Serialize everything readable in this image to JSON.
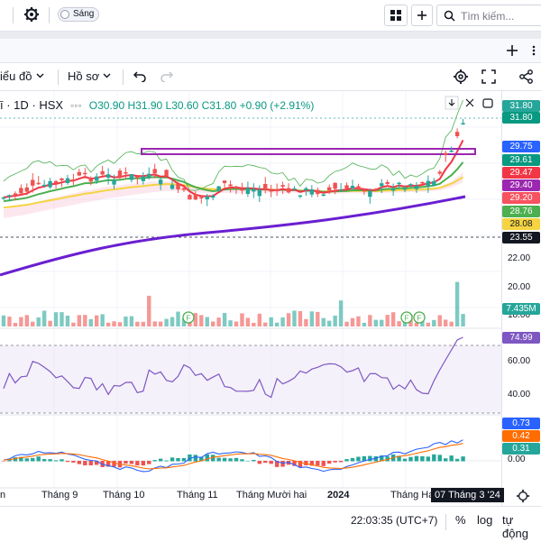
{
  "topbar": {
    "theme_toggle_label": "Sáng",
    "search_placeholder": "Tìm kiếm..."
  },
  "toolbar": {
    "indicators_label": "iểu đồ",
    "templates_label": "Hồ sơ"
  },
  "legend": {
    "symbol": "ī · 1D · HSX",
    "open": "O30.90",
    "high": "H31.90",
    "low": "L30.60",
    "close": "C31.80",
    "change": "+0.90 (+2.91%)"
  },
  "price_axis": {
    "tags": [
      {
        "text": "31.80",
        "color": "#26a69a"
      },
      {
        "text": "31.80",
        "color": "#089981"
      },
      {
        "text": "29.75",
        "color": "#2962ff"
      },
      {
        "text": "29.61",
        "color": "#089981"
      },
      {
        "text": "29.47",
        "color": "#f23645"
      },
      {
        "text": "29.40",
        "color": "#9c27b0"
      },
      {
        "text": "29.20",
        "color": "#f7525f"
      },
      {
        "text": "28.76",
        "color": "#4caf50"
      },
      {
        "text": "28.08",
        "color": "#f5d442"
      },
      {
        "text": "23.55",
        "color": "#131722"
      }
    ],
    "ticks": [
      "22.00",
      "20.00",
      "18.00"
    ],
    "volume_tag": "7.435M",
    "rsi_tag": "74.99",
    "rsi_ticks": [
      "60.00",
      "40.00"
    ],
    "macd_tags": [
      {
        "text": "0.73",
        "color": "#2962ff"
      },
      {
        "text": "0.42",
        "color": "#ff6d00"
      },
      {
        "text": "0.31",
        "color": "#26a69a"
      }
    ],
    "macd_tick": "0.00"
  },
  "time_axis": {
    "labels": [
      "n",
      "Tháng 9",
      "Tháng 10",
      "Tháng 11",
      "Tháng Mười hai",
      "2024",
      "Tháng Ha"
    ],
    "cursor_label": "07 Tháng 3 '24"
  },
  "statusbar": {
    "clock": "22:03:35 (UTC+7)",
    "percent_label": "%",
    "log_label": "log",
    "auto_label": "tự động"
  },
  "colors": {
    "up": "#26a69a",
    "down": "#ef5350",
    "ema_fast": "#f23645",
    "ema_mid": "#4caf50",
    "ema_slow": "#f5d442",
    "ema_long": "#6a1fd1",
    "rsi": "#7e57c2",
    "macd": "#2962ff",
    "signal": "#ff6d00"
  }
}
